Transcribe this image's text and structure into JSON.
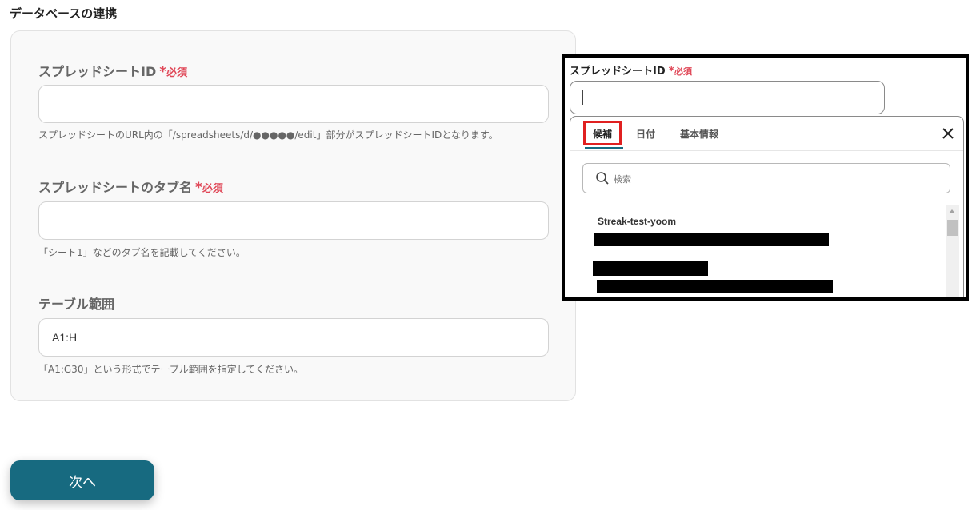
{
  "section": {
    "title": "データベースの連携"
  },
  "form": {
    "spreadsheet_id": {
      "label": "スプレッドシートID",
      "required_star": "*",
      "required_text": "必須",
      "value": "",
      "help": "スプレッドシートのURL内の「/spreadsheets/d/●●●●●/edit」部分がスプレッドシートIDとなります。"
    },
    "tab_name": {
      "label": "スプレッドシートのタブ名",
      "required_star": "*",
      "required_text": "必須",
      "value": "",
      "help": "「シート1」などのタブ名を記載してください。"
    },
    "table_range": {
      "label": "テーブル範囲",
      "value": "A1:H",
      "help": "「A1:G30」という形式でテーブル範囲を指定してください。"
    }
  },
  "next_button": {
    "label": "次へ"
  },
  "inset": {
    "label": "スプレッドシートID",
    "required_star": "*",
    "required_text": "必須",
    "tabs": [
      {
        "label": "候補",
        "active": true
      },
      {
        "label": "日付",
        "active": false
      },
      {
        "label": "基本情報",
        "active": false
      }
    ],
    "search_placeholder": "検索",
    "results": [
      {
        "name": "Streak-test-yoom"
      }
    ]
  },
  "colors": {
    "accent": "#176a80",
    "required": "#e04858",
    "highlight_box": "#e02020"
  },
  "icons": [
    "close-icon",
    "search-icon"
  ]
}
